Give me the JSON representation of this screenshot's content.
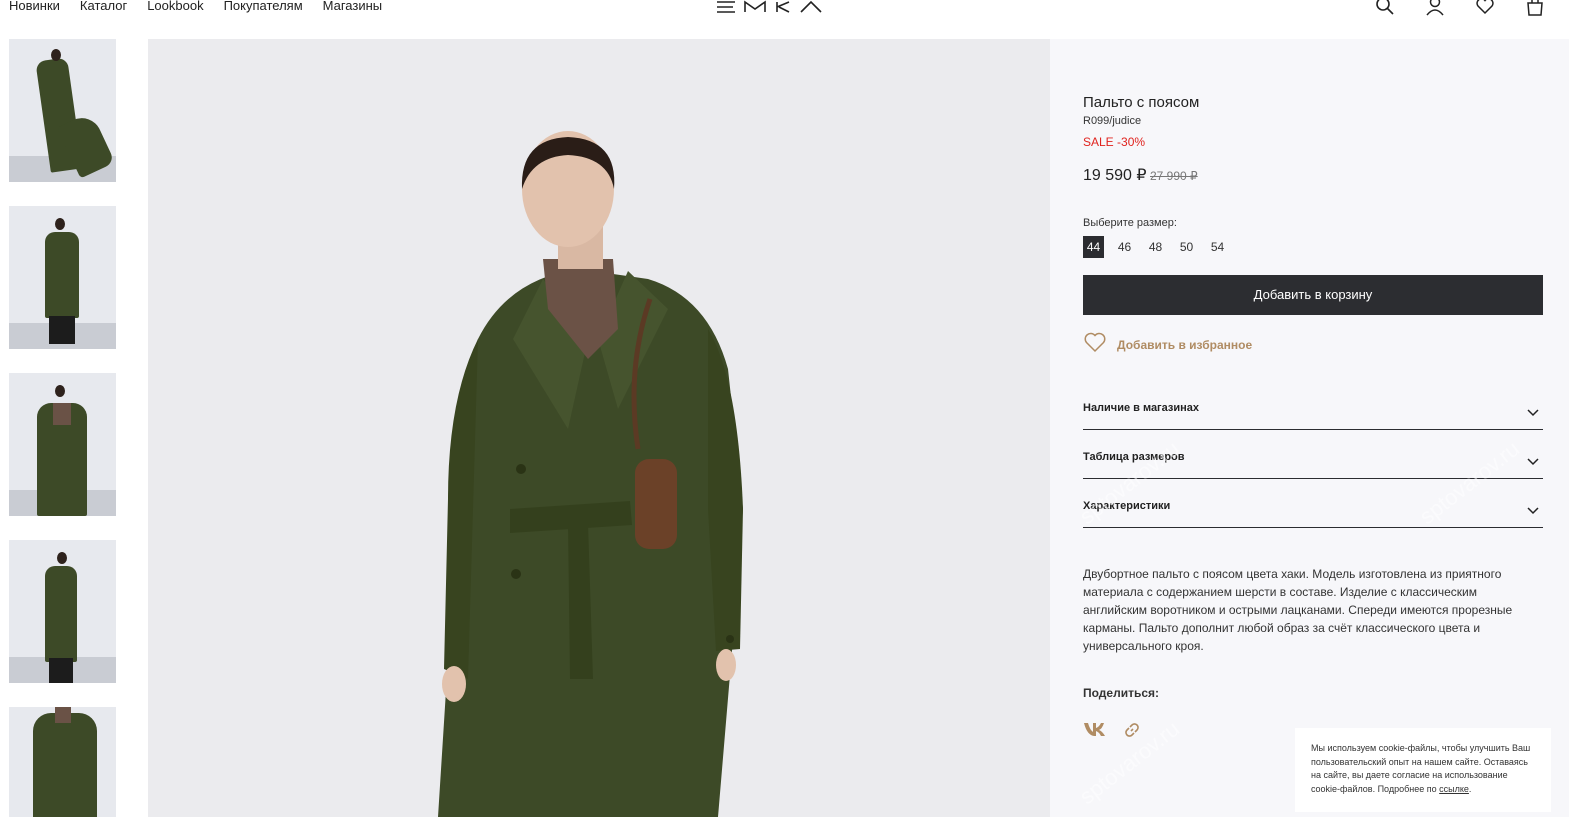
{
  "header": {
    "nav": [
      "Новинки",
      "Каталог",
      "Lookbook",
      "Покупателям",
      "Магазины"
    ],
    "logo": "EMKA",
    "icons": [
      "search-icon",
      "user-icon",
      "heart-icon",
      "bag-icon"
    ]
  },
  "thumbnails": [
    "thumb-1",
    "thumb-2",
    "thumb-3",
    "thumb-4",
    "thumb-5"
  ],
  "product": {
    "title": "Пальто с поясом",
    "sku": "R099/judice",
    "sale": "SALE -30%",
    "price": "19 590 ₽",
    "old_price": "27 990 ₽",
    "size_label": "Выберите размер:",
    "sizes": [
      "44",
      "46",
      "48",
      "50",
      "54"
    ],
    "selected_size": "44",
    "add_to_cart": "Добавить в корзину",
    "add_to_fav": "Добавить в избранное",
    "accordions": [
      "Наличие в магазинах",
      "Таблица размеров",
      "Характеристики"
    ],
    "description": "Двубортное пальто с поясом цвета хаки. Модель изготовлена из приятного материала с содержанием шерсти в составе. Изделие с классическим английским воротником и острыми лацканами. Спереди имеются прорезные карманы. Пальто дополнит любой образ за счёт классического цвета и универсального кроя.",
    "share_label": "Поделиться:",
    "share_icons": [
      "vk-icon",
      "link-icon"
    ]
  },
  "cookie": {
    "text": "Мы используем cookie-файлы, чтобы улучшить Ваш пользовательский опыт на нашем сайте. Оставаясь на сайте, вы даете согласие на использование cookie-файлов. Подробнее по ",
    "link": "ссылке",
    "tail": "."
  },
  "watermark": "sptovarov.ru",
  "colors": {
    "accent": "#2c2d31",
    "sale": "#e0231e",
    "gold": "#b08c63",
    "panel_bg": "#f7f7fa"
  }
}
